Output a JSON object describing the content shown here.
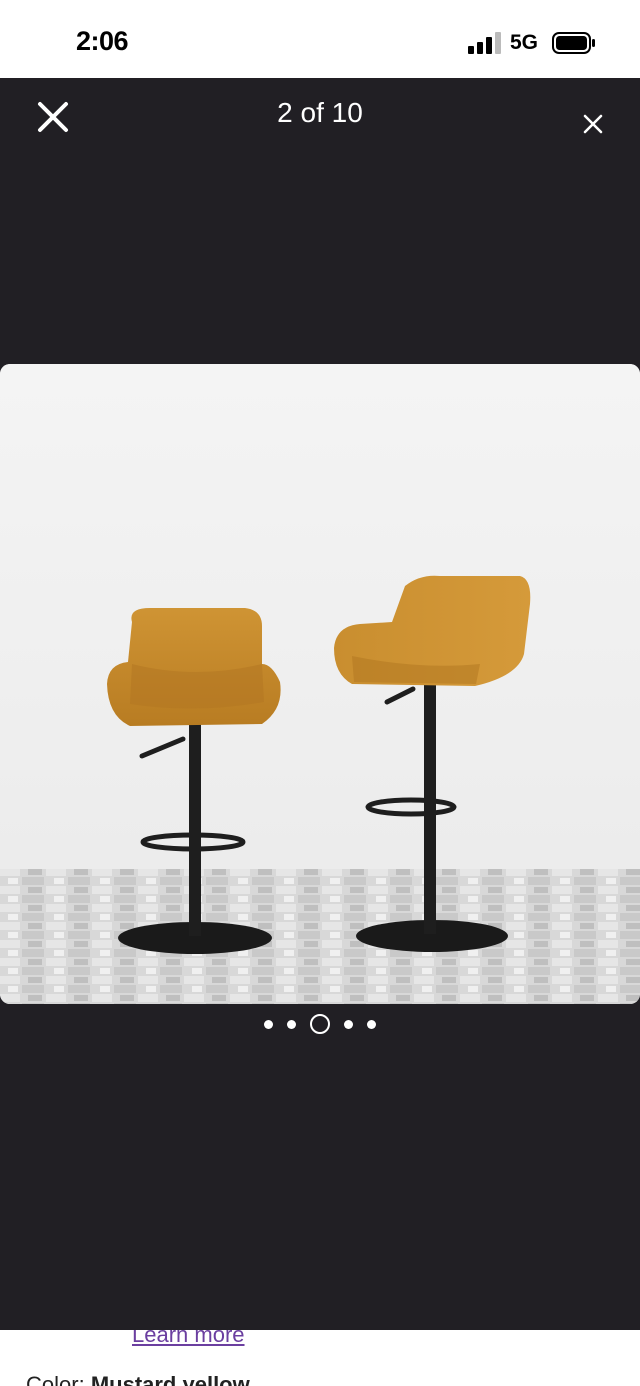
{
  "status_bar": {
    "time": "2:06",
    "network": "5G"
  },
  "viewer": {
    "counter": "2 of 10",
    "dots": {
      "count": 5,
      "active_index": 2
    }
  },
  "page": {
    "learn_more": "Learn more",
    "color_label": "Color:",
    "color_value": "Mustard yellow"
  },
  "colors": {
    "viewer_background": "#211f24",
    "seat": "#c98e2f",
    "metal": "#1e1e1e",
    "link": "#6b3fa0"
  }
}
